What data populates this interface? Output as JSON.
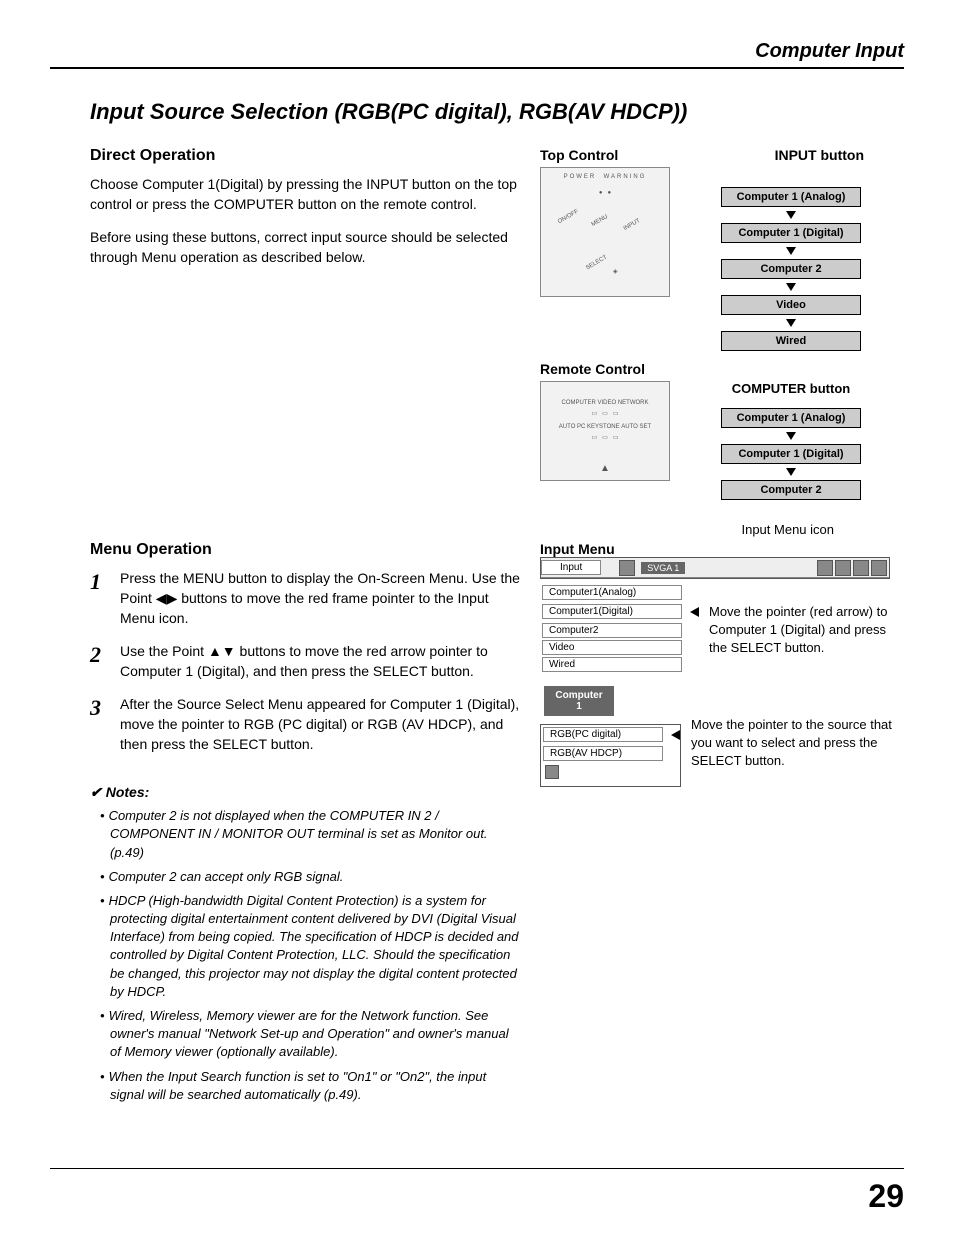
{
  "header": {
    "section_title": "Computer Input"
  },
  "title": "Input Source Selection (RGB(PC digital), RGB(AV HDCP))",
  "direct_op": {
    "heading": "Direct Operation",
    "p1": "Choose Computer 1(Digital) by pressing the INPUT button on the top control or press the COMPUTER button on the remote control.",
    "p2": "Before using these buttons, correct input source should be selected through Menu operation as described below."
  },
  "menu_op": {
    "heading": "Menu Operation",
    "steps": [
      "Press the MENU button to display the On-Screen Menu. Use the Point ◀▶ buttons to move the red frame pointer to the Input Menu icon.",
      "Use the Point ▲▼ buttons to move the red arrow pointer to Computer 1 (Digital), and then press the SELECT button.",
      "After the Source Select Menu appeared for Computer 1 (Digital), move the pointer to RGB (PC digital) or RGB (AV HDCP), and then press the SELECT button."
    ]
  },
  "notes": {
    "heading": "Notes:",
    "items": [
      "Computer 2 is not displayed when the COMPUTER IN 2 / COMPONENT IN / MONITOR OUT terminal is set as Monitor out. (p.49)",
      "Computer 2 can accept only RGB signal.",
      "HDCP (High-bandwidth Digital Content Protection) is a system for protecting digital entertainment content delivered by DVI (Digital Visual Interface) from being copied.  The specification of HDCP is decided and controlled by Digital Content Protection, LLC. Should the specification be changed, this projector may not display the digital content protected by HDCP.",
      "Wired, Wireless, Memory viewer are for the Network  function. See owner's manual \"Network Set-up and Operation\" and owner's manual of Memory viewer (optionally available).",
      "When the Input Search function is set to \"On1\" or \"On2\", the input signal will be searched automatically (p.49)."
    ]
  },
  "right": {
    "top_control_label": "Top Control",
    "input_button_label": "INPUT button",
    "input_chain": [
      "Computer 1 (Analog)",
      "Computer 1 (Digital)",
      "Computer 2",
      "Video",
      "Wired"
    ],
    "remote_control_label": "Remote Control",
    "computer_button_label": "COMPUTER button",
    "computer_chain": [
      "Computer 1 (Analog)",
      "Computer 1 (Digital)",
      "Computer 2"
    ],
    "input_menu_icon_label": "Input Menu icon",
    "input_menu_label": "Input Menu",
    "menu_tab": "Input",
    "svga": "SVGA 1",
    "menu_items": [
      "Computer1(Analog)",
      "Computer1(Digital)",
      "Computer2",
      "Video",
      "Wired"
    ],
    "caption1": "Move the pointer (red arrow) to Computer 1 (Digital) and press the SELECT button.",
    "computer_tab": "Computer 1",
    "source_items": [
      "RGB(PC digital)",
      "RGB(AV HDCP)"
    ],
    "caption2": "Move the pointer to the source that you want to select and press the SELECT button.",
    "top_panel_labels": {
      "power": "POWER",
      "warning": "WARNING",
      "onoff": "ON/OFF",
      "menu": "MENU",
      "input": "INPUT",
      "select": "SELECT"
    },
    "remote_labels": {
      "computer": "COMPUTER",
      "video": "VIDEO",
      "network": "NETWORK",
      "autopc": "AUTO PC",
      "keystone": "KEYSTONE",
      "autoset": "AUTO SET"
    }
  },
  "page_number": "29"
}
